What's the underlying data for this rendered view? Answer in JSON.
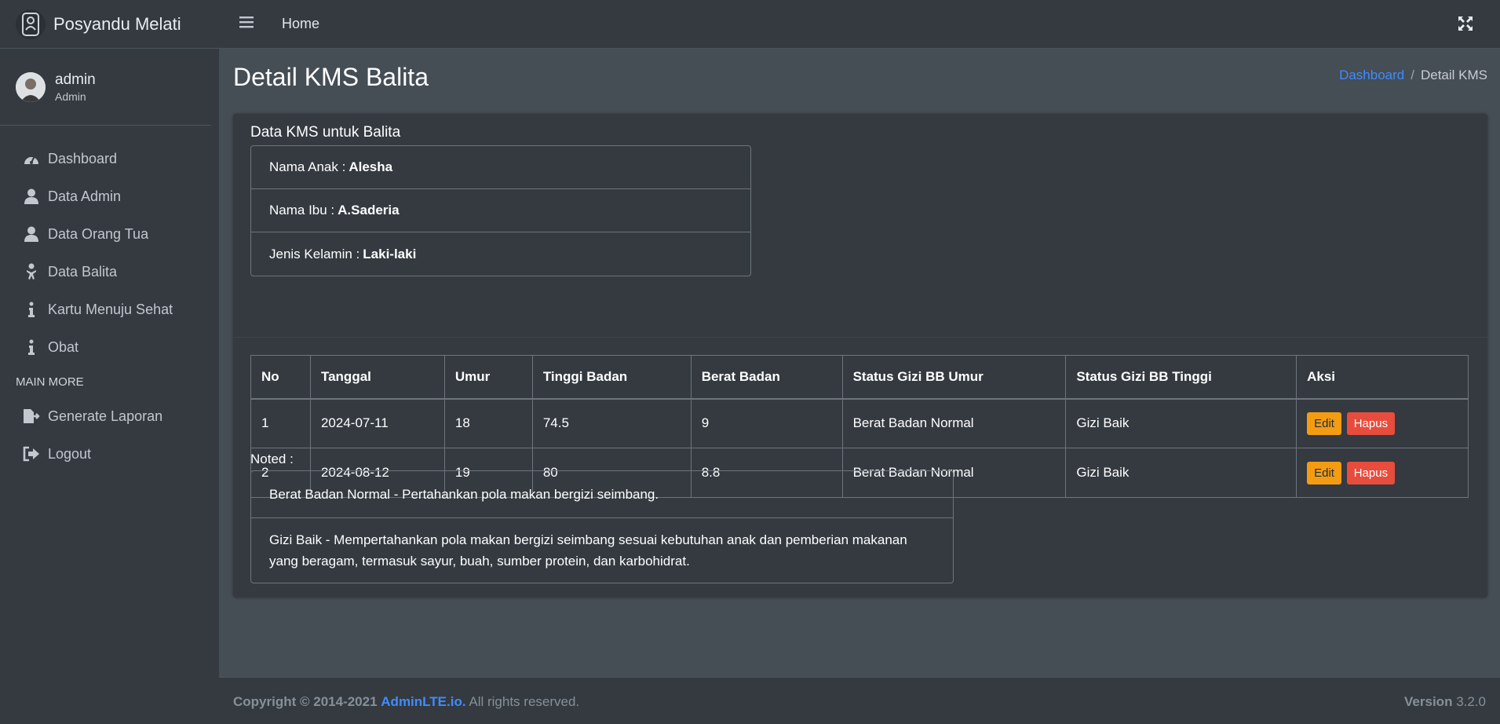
{
  "brand": {
    "name": "Posyandu Melati"
  },
  "user": {
    "name": "admin",
    "role": "Admin"
  },
  "sidebar": {
    "items": [
      {
        "label": "Dashboard",
        "icon": "tachometer-icon"
      },
      {
        "label": "Data Admin",
        "icon": "user-icon"
      },
      {
        "label": "Data Orang Tua",
        "icon": "user-icon"
      },
      {
        "label": "Data Balita",
        "icon": "baby-icon"
      },
      {
        "label": "Kartu Menuju Sehat",
        "icon": "info-icon"
      },
      {
        "label": "Obat",
        "icon": "info-icon"
      }
    ],
    "section_header": "MAIN MORE",
    "more_items": [
      {
        "label": "Generate Laporan",
        "icon": "file-export-icon"
      },
      {
        "label": "Logout",
        "icon": "sign-out-icon"
      }
    ]
  },
  "topbar": {
    "home_label": "Home"
  },
  "page": {
    "title": "Detail KMS Balita",
    "breadcrumb": {
      "link": "Dashboard",
      "separator": "/",
      "current": "Detail KMS"
    }
  },
  "card": {
    "title": "Data KMS untuk Balita",
    "info": [
      {
        "label": "Nama Anak :",
        "value": "Alesha"
      },
      {
        "label": "Nama Ibu :",
        "value": "A.Saderia"
      },
      {
        "label": "Jenis Kelamin :",
        "value": "Laki-laki"
      }
    ]
  },
  "table": {
    "headers": [
      "No",
      "Tanggal",
      "Umur",
      "Tinggi Badan",
      "Berat Badan",
      "Status Gizi BB Umur",
      "Status Gizi BB Tinggi",
      "Aksi"
    ],
    "rows": [
      {
        "no": "1",
        "tanggal": "2024-07-11",
        "umur": "18",
        "tinggi": "74.5",
        "berat": "9",
        "status_umur": "Berat Badan Normal",
        "status_tinggi": "Gizi Baik"
      },
      {
        "no": "2",
        "tanggal": "2024-08-12",
        "umur": "19",
        "tinggi": "80",
        "berat": "8.8",
        "status_umur": "Berat Badan Normal",
        "status_tinggi": "Gizi Baik"
      }
    ],
    "edit_label": "Edit",
    "delete_label": "Hapus"
  },
  "noted": {
    "label": "Noted :",
    "items": [
      "Berat Badan Normal - Pertahankan pola makan bergizi seimbang.",
      "Gizi Baik - Mempertahankan pola makan bergizi seimbang sesuai kebutuhan anak dan pemberian makanan yang beragam, termasuk sayur, buah, sumber protein, dan karbohidrat."
    ]
  },
  "footer": {
    "copyright": "Copyright © 2014-2021",
    "link": "AdminLTE.io.",
    "rights": "All rights reserved.",
    "version_label": "Version",
    "version_value": "3.2.0"
  },
  "colors": {
    "sidebar_bg": "#343a40",
    "content_bg": "#454d55",
    "link": "#3f8cff",
    "edit_button": "#f39c12",
    "delete_button": "#e74c3c"
  }
}
